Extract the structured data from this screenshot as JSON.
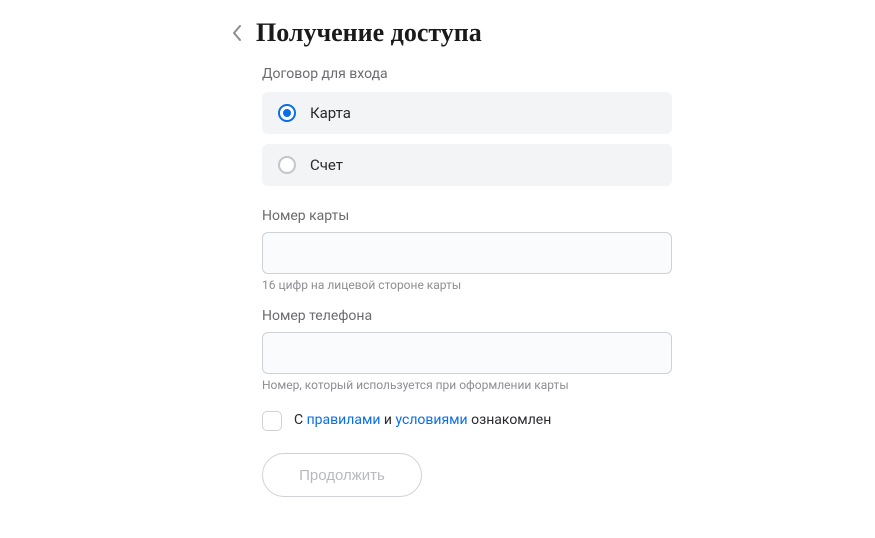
{
  "header": {
    "title": "Получение доступа"
  },
  "form": {
    "contract_label": "Договор для входа",
    "options": {
      "card": "Карта",
      "account": "Счет"
    },
    "card_number": {
      "label": "Номер карты",
      "value": "",
      "hint": "16 цифр на лицевой стороне карты"
    },
    "phone": {
      "label": "Номер телефона",
      "value": "",
      "hint": "Номер, который используется при оформлении карты"
    },
    "agreement": {
      "prefix": "С ",
      "rules_link": "правилами",
      "mid": " и ",
      "terms_link": "условиями",
      "suffix": " ознакомлен"
    },
    "submit_label": "Продолжить"
  }
}
